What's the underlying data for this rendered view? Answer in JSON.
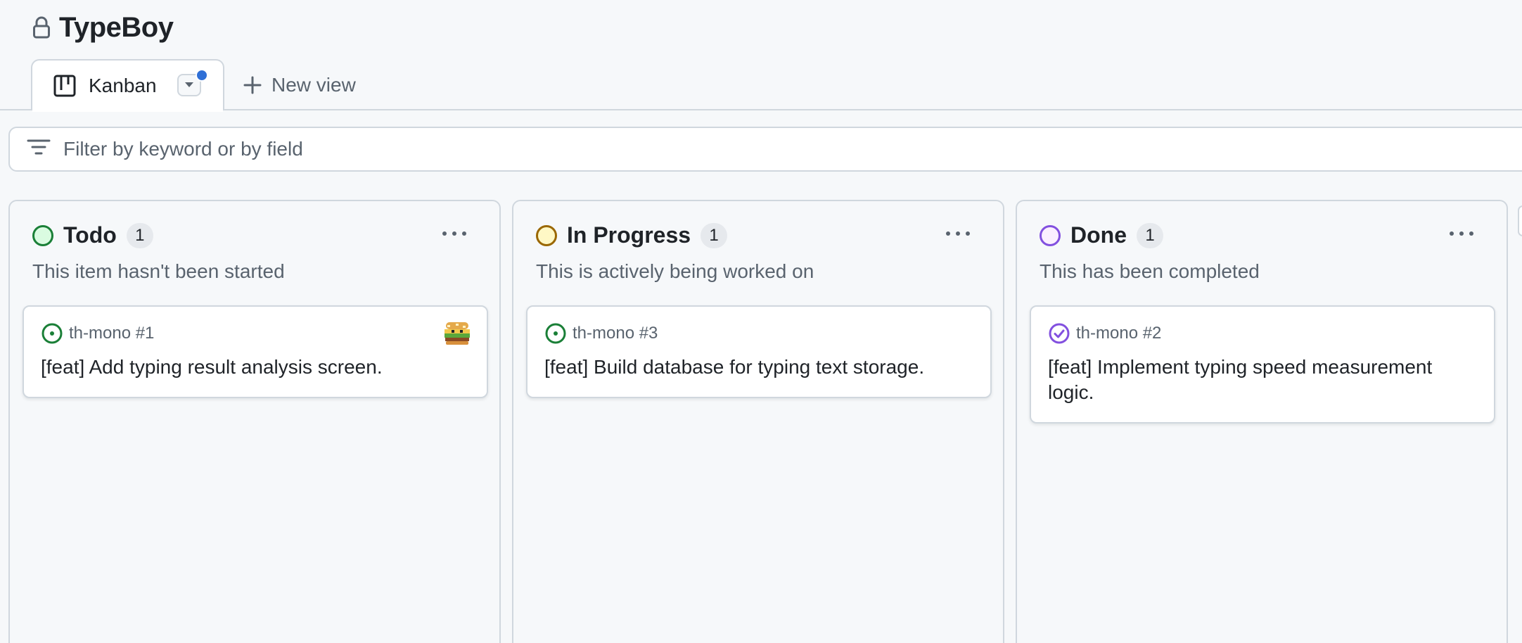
{
  "project": {
    "title": "TypeBoy",
    "lock_icon": "lock-icon"
  },
  "tabs": {
    "active": {
      "label": "Kanban",
      "icon": "table-board-icon",
      "has_unsaved_changes": true
    },
    "new_view_label": "New view"
  },
  "filter": {
    "placeholder": "Filter by keyword or by field",
    "value": ""
  },
  "columns": [
    {
      "title": "Todo",
      "count": "1",
      "description": "This item hasn't been started",
      "status_color": "#1a7f37",
      "status_fill": "#dafbe1",
      "card": {
        "ref": "th-mono #1",
        "title": "[feat] Add typing result analysis screen.",
        "icon": "issue-open-icon",
        "has_avatar": true
      }
    },
    {
      "title": "In Progress",
      "count": "1",
      "description": "This is actively being worked on",
      "status_color": "#9a6700",
      "status_fill": "#fff8c5",
      "card": {
        "ref": "th-mono #3",
        "title": "[feat] Build database for typing text storage.",
        "icon": "issue-open-icon",
        "has_avatar": false
      }
    },
    {
      "title": "Done",
      "count": "1",
      "description": "This has been completed",
      "status_color": "#8250df",
      "status_fill": "#fbefff",
      "card": {
        "ref": "th-mono #2",
        "title": "[feat] Implement typing speed measurement logic.",
        "icon": "issue-closed-icon",
        "has_avatar": false
      }
    }
  ],
  "colors": {
    "accent_blue": "#2f6fd6",
    "open_green": "#1a7f37",
    "closed_purple": "#8250df",
    "border": "#d0d7de",
    "muted_text": "#59636e"
  }
}
